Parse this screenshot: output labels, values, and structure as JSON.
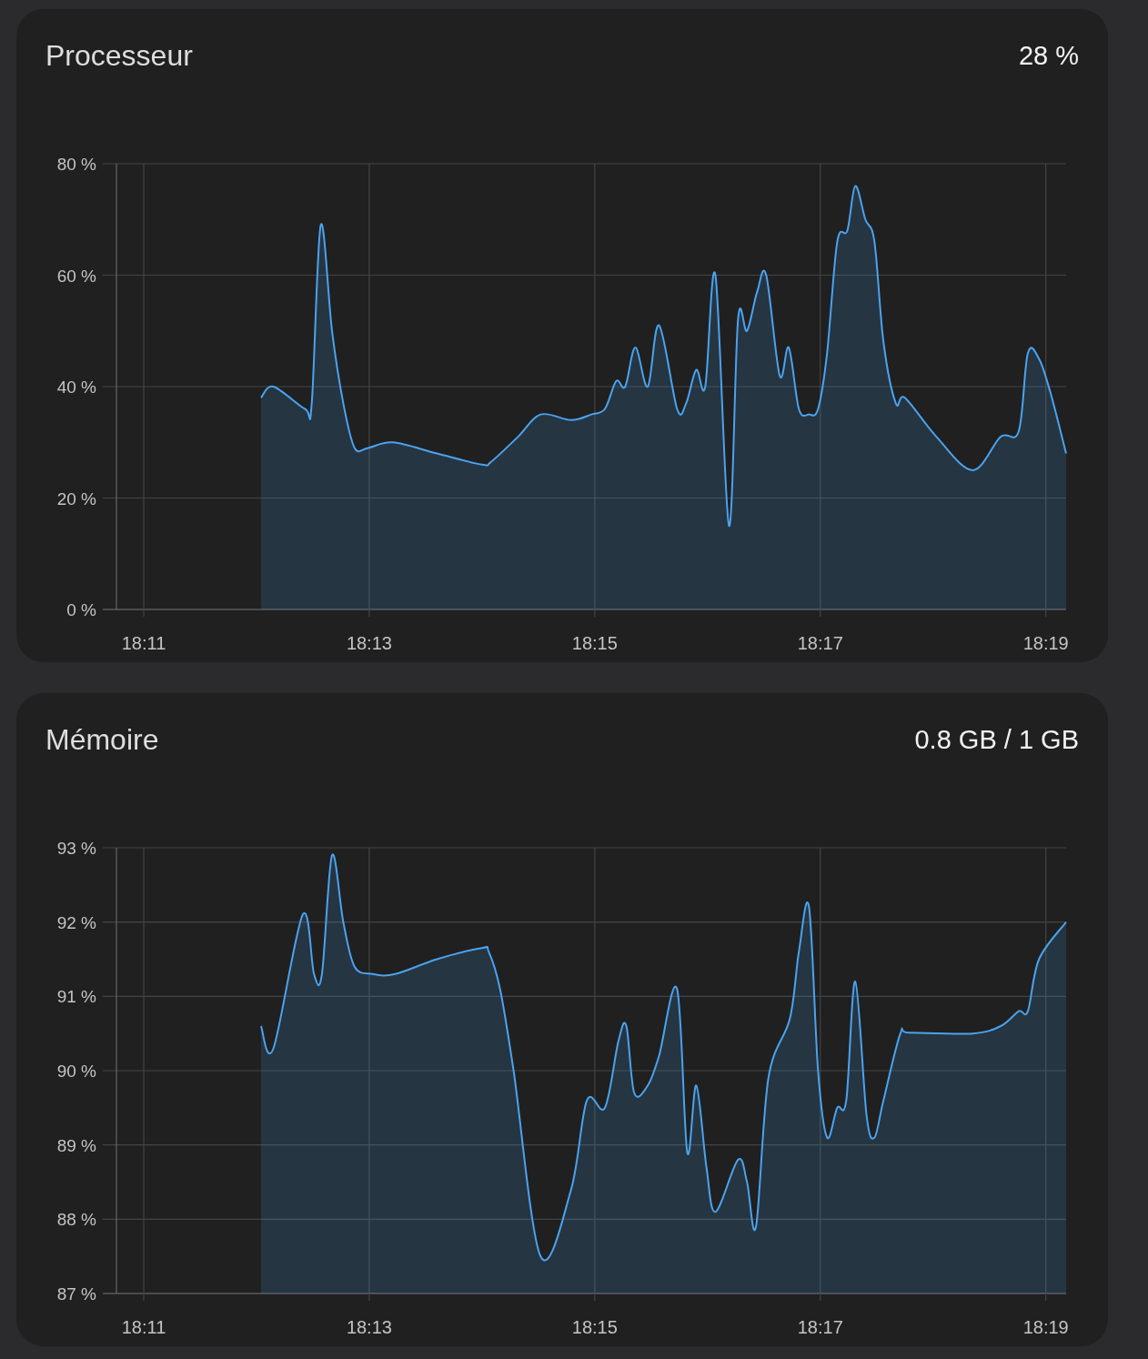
{
  "cards": [
    {
      "title": "Processeur",
      "value": "28 %",
      "chart_data": {
        "type": "area",
        "grid": true,
        "xlim": [
          1090.758,
          1099.18
        ],
        "ylim": [
          0,
          80
        ],
        "yticks": [
          {
            "value": 0,
            "label": "0 %"
          },
          {
            "value": 20,
            "label": "20 %"
          },
          {
            "value": 40,
            "label": "40 %"
          },
          {
            "value": 60,
            "label": "60 %"
          },
          {
            "value": 80,
            "label": "80 %"
          }
        ],
        "xticks": [
          {
            "value": 1091,
            "label": "18:11"
          },
          {
            "value": 1093,
            "label": "18:13"
          },
          {
            "value": 1095,
            "label": "18:15"
          },
          {
            "value": 1097,
            "label": "18:17"
          },
          {
            "value": 1099,
            "label": "18:19"
          }
        ],
        "x": [
          1092.04,
          1092.15,
          1092.43,
          1092.49,
          1092.57,
          1092.67,
          1092.77,
          1092.87,
          1092.99,
          1093.21,
          1093.6,
          1094.0,
          1094.08,
          1094.32,
          1094.52,
          1094.79,
          1094.97,
          1095.09,
          1095.19,
          1095.27,
          1095.36,
          1095.47,
          1095.57,
          1095.73,
          1095.81,
          1095.9,
          1095.98,
          1096.07,
          1096.19,
          1096.27,
          1096.35,
          1096.44,
          1096.52,
          1096.64,
          1096.72,
          1096.81,
          1096.9,
          1096.98,
          1097.06,
          1097.15,
          1097.24,
          1097.31,
          1097.4,
          1097.48,
          1097.56,
          1097.67,
          1097.75,
          1098.03,
          1098.35,
          1098.6,
          1098.76,
          1098.84,
          1098.94,
          1099.04,
          1099.18
        ],
        "series": [
          {
            "color": "#4aa3f0",
            "values": [
              38,
              40,
              36,
              37,
              69,
              50,
              37,
              29,
              29,
              30,
              28,
              26,
              26.5,
              31,
              35,
              34,
              35,
              36,
              41,
              40,
              47,
              40,
              51,
              36,
              37,
              43,
              40,
              60,
              15,
              52,
              50,
              57,
              60,
              42,
              47,
              36,
              35,
              36,
              46,
              66,
              68,
              76,
              70,
              66,
              48,
              37,
              38,
              31,
              25,
              31,
              32,
              46,
              45,
              39,
              28
            ]
          }
        ]
      }
    },
    {
      "title": "Mémoire",
      "value": "0.8 GB / 1 GB",
      "chart_data": {
        "type": "area",
        "grid": true,
        "xlim": [
          1090.758,
          1099.18
        ],
        "ylim": [
          87,
          93
        ],
        "yticks": [
          {
            "value": 87,
            "label": "87 %"
          },
          {
            "value": 88,
            "label": "88 %"
          },
          {
            "value": 89,
            "label": "89 %"
          },
          {
            "value": 90,
            "label": "90 %"
          },
          {
            "value": 91,
            "label": "91 %"
          },
          {
            "value": 92,
            "label": "92 %"
          },
          {
            "value": 93,
            "label": "93 %"
          }
        ],
        "xticks": [
          {
            "value": 1091,
            "label": "18:11"
          },
          {
            "value": 1093,
            "label": "18:13"
          },
          {
            "value": 1095,
            "label": "18:15"
          },
          {
            "value": 1097,
            "label": "18:17"
          },
          {
            "value": 1099,
            "label": "18:19"
          }
        ],
        "x": [
          1092.04,
          1092.15,
          1092.41,
          1092.51,
          1092.58,
          1092.67,
          1092.77,
          1092.87,
          1093.03,
          1093.23,
          1093.6,
          1094.0,
          1094.06,
          1094.16,
          1094.28,
          1094.52,
          1094.79,
          1094.93,
          1095.09,
          1095.21,
          1095.28,
          1095.35,
          1095.47,
          1095.57,
          1095.73,
          1095.82,
          1095.9,
          1095.99,
          1096.07,
          1096.27,
          1096.35,
          1096.43,
          1096.54,
          1096.73,
          1096.81,
          1096.9,
          1096.98,
          1097.06,
          1097.15,
          1097.23,
          1097.31,
          1097.41,
          1097.48,
          1097.56,
          1097.71,
          1097.79,
          1098.35,
          1098.6,
          1098.76,
          1098.84,
          1098.94,
          1099.18
        ],
        "series": [
          {
            "color": "#4aa3f0",
            "values": [
              90.6,
              90.3,
              92.1,
              91.3,
              91.3,
              92.9,
              92.0,
              91.4,
              91.3,
              91.3,
              91.5,
              91.65,
              91.6,
              91.1,
              90.0,
              87.5,
              88.4,
              89.6,
              89.5,
              90.4,
              90.6,
              89.7,
              89.8,
              90.2,
              91.1,
              88.9,
              89.8,
              88.7,
              88.1,
              88.8,
              88.5,
              87.9,
              89.9,
              90.7,
              91.6,
              92.2,
              90.0,
              89.1,
              89.5,
              89.6,
              91.2,
              89.4,
              89.1,
              89.6,
              90.5,
              90.51,
              90.5,
              90.6,
              90.8,
              90.8,
              91.5,
              92.0
            ]
          }
        ]
      }
    }
  ]
}
